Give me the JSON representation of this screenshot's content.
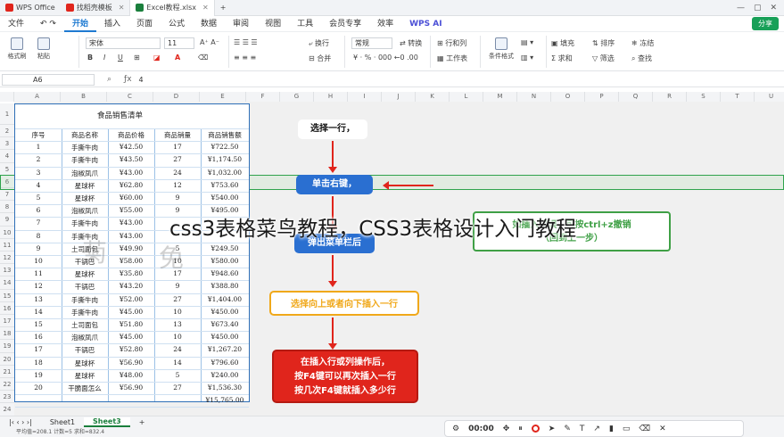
{
  "titlebar": {
    "tabs": [
      {
        "label": "WPS Office",
        "color": "#e0251c"
      },
      {
        "label": "找稻壳模板",
        "color": "#e0251c"
      },
      {
        "label": "Excel教程.xlsx",
        "color": "#1a7f3c"
      }
    ]
  },
  "menubar": {
    "items": [
      "文件",
      "开始",
      "插入",
      "页面",
      "公式",
      "数据",
      "审阅",
      "视图",
      "工具",
      "会员专享",
      "效率",
      "WPS AI"
    ],
    "active": "开始",
    "share_label": "分享"
  },
  "ribbon": {
    "format_painter": "格式刷",
    "paste": "粘贴",
    "font_name": "宋体",
    "font_size": "11",
    "wrap": "换行",
    "merge": "合并",
    "number_format": "常规",
    "convert": "转换",
    "row_col": "行和列",
    "worksheet": "工作表",
    "cond_format": "条件格式",
    "fill": "填充",
    "sum": "求和",
    "sort": "排序",
    "filter": "筛选",
    "freeze": "冻结",
    "find": "查找"
  },
  "formulabar": {
    "cell_ref": "A6",
    "value": "4"
  },
  "columns": [
    "A",
    "B",
    "C",
    "D",
    "E",
    "F",
    "G",
    "H",
    "I",
    "J",
    "K",
    "L",
    "M",
    "N",
    "O",
    "P",
    "Q",
    "R",
    "S",
    "T",
    "U"
  ],
  "rows": [
    "1",
    "2",
    "3",
    "4",
    "5",
    "6",
    "7",
    "8",
    "9",
    "10",
    "11",
    "12",
    "13",
    "14",
    "15",
    "16",
    "17",
    "18",
    "19",
    "20",
    "21",
    "22",
    "23",
    "24",
    "25"
  ],
  "table": {
    "title": "食品销售清单",
    "headers": [
      "序号",
      "商品名称",
      "商品价格",
      "商品销量",
      "商品销售额"
    ],
    "rows": [
      [
        "1",
        "手撕牛肉",
        "¥42.50",
        "17",
        "¥722.50"
      ],
      [
        "2",
        "手撕牛肉",
        "¥43.50",
        "27",
        "¥1,174.50"
      ],
      [
        "3",
        "泡椒凤爪",
        "¥43.00",
        "24",
        "¥1,032.00"
      ],
      [
        "4",
        "星球杯",
        "¥62.80",
        "12",
        "¥753.60"
      ],
      [
        "5",
        "星球杯",
        "¥60.00",
        "9",
        "¥540.00"
      ],
      [
        "6",
        "泡椒凤爪",
        "¥55.00",
        "9",
        "¥495.00"
      ],
      [
        "7",
        "手撕牛肉",
        "¥43.00",
        "",
        ""
      ],
      [
        "8",
        "手撕牛肉",
        "¥43.00",
        "",
        ""
      ],
      [
        "9",
        "土司面包",
        "¥49.90",
        "5",
        "¥249.50"
      ],
      [
        "10",
        "干锅巴",
        "¥58.00",
        "10",
        "¥580.00"
      ],
      [
        "11",
        "星球杯",
        "¥35.80",
        "17",
        "¥948.60"
      ],
      [
        "12",
        "干锅巴",
        "¥43.20",
        "9",
        "¥388.80"
      ],
      [
        "13",
        "手撕牛肉",
        "¥52.00",
        "27",
        "¥1,404.00"
      ],
      [
        "14",
        "手撕牛肉",
        "¥45.00",
        "10",
        "¥450.00"
      ],
      [
        "15",
        "土司面包",
        "¥51.80",
        "13",
        "¥673.40"
      ],
      [
        "16",
        "泡椒凤爪",
        "¥45.00",
        "10",
        "¥450.00"
      ],
      [
        "17",
        "干锅巴",
        "¥52.80",
        "24",
        "¥1,267.20"
      ],
      [
        "18",
        "星球杯",
        "¥56.90",
        "14",
        "¥796.60"
      ],
      [
        "19",
        "星球杯",
        "¥48.00",
        "5",
        "¥240.00"
      ],
      [
        "20",
        "干脆面怎么",
        "¥56.90",
        "27",
        "¥1,536.30"
      ]
    ],
    "total": "¥15,765.00"
  },
  "flow": {
    "step1": "选择一行，",
    "step2": "单击右键，",
    "step3": "弹出菜单栏后",
    "step4": "选择向上或者向下插入一行",
    "step5_line1": "在插入行或列操作后，",
    "step5_line2": "按F4键可以再次插入一行",
    "step5_line3": "按几次F4键就插入多少行"
  },
  "green_note": {
    "line1": "如插入错误，可按ctrl+z撤销",
    "line2": "（回到上一步）"
  },
  "overlay_title": "css3表格菜鸟教程，CSS3表格设计入门教程",
  "watermark_chars": [
    "菊",
    "免"
  ],
  "sheets": [
    "Sheet1",
    "Sheet3"
  ],
  "active_sheet": "Sheet3",
  "status": "平均值=208.1  计数=5  求和=832.4",
  "recorder": {
    "time": "00:00"
  }
}
